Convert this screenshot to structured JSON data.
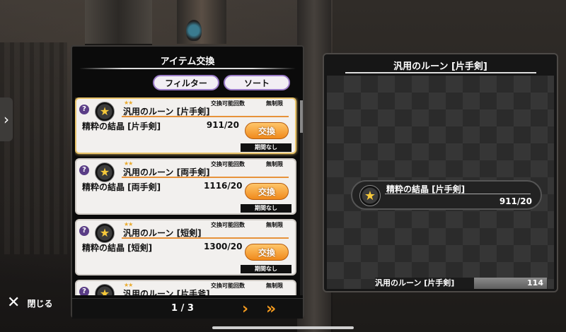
{
  "left_panel": {
    "title": "アイテム交換",
    "filter_label": "フィルター",
    "sort_label": "ソート"
  },
  "cards": [
    {
      "name": "汎用のルーン [片手剣]",
      "material": "精粋の結晶 [片手剣]",
      "count": "911/20",
      "exchange_label": "交換可能回数",
      "exchange_value": "無制限",
      "button": "交換",
      "period": "期間なし",
      "rarity": "★★",
      "help": "?",
      "selected": true
    },
    {
      "name": "汎用のルーン [両手剣]",
      "material": "精粋の結晶 [両手剣]",
      "count": "1116/20",
      "exchange_label": "交換可能回数",
      "exchange_value": "無制限",
      "button": "交換",
      "period": "期間なし",
      "rarity": "★★",
      "help": "?"
    },
    {
      "name": "汎用のルーン [短剣]",
      "material": "精粋の結晶 [短剣]",
      "count": "1300/20",
      "exchange_label": "交換可能回数",
      "exchange_value": "無制限",
      "button": "交換",
      "period": "期間なし",
      "rarity": "★★",
      "help": "?"
    },
    {
      "name": "汎用のルーン [片手斧]",
      "exchange_label": "交換可能回数",
      "exchange_value": "無制限",
      "rarity": "★★",
      "help": "?"
    }
  ],
  "pager": {
    "text": "1 / 3",
    "next": "›",
    "last": "»"
  },
  "right_panel": {
    "title": "汎用のルーン [片手剣]",
    "material_name": "精粋の結晶 [片手剣]",
    "material_count": "911/20",
    "owned_name": "汎用のルーン [片手剣]",
    "owned_count": "114"
  },
  "close_label": "閉じる",
  "side_tab": "›",
  "accent_orange": "#f08a1c",
  "accent_purple": "#9c7cc9"
}
